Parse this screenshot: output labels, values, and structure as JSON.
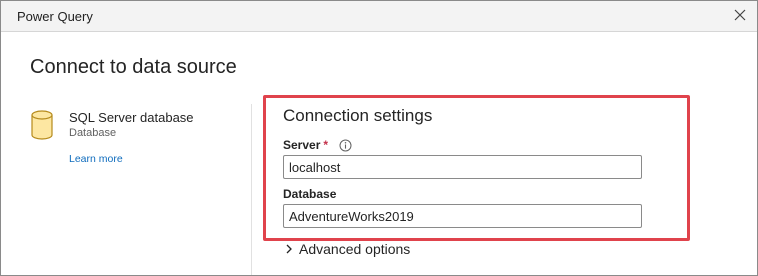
{
  "window": {
    "title": "Power Query",
    "close_icon": "close-icon"
  },
  "page": {
    "title": "Connect to data source"
  },
  "source": {
    "icon": "database-cylinder-icon",
    "icon_color": "#fde7a2",
    "name": "SQL Server database",
    "type": "Database",
    "learn_more": "Learn more"
  },
  "connection": {
    "section_title": "Connection settings",
    "server_label": "Server",
    "server_required_mark": "*",
    "server_info_icon": "info-icon",
    "server_value": "localhost",
    "database_label": "Database",
    "database_value": "AdventureWorks2019",
    "highlight_color": "#e0434c"
  },
  "advanced": {
    "label": "Advanced options",
    "icon": "chevron-right-icon"
  },
  "colors": {
    "link": "#0f6cbd",
    "titlebar": "#f3f3f3"
  }
}
